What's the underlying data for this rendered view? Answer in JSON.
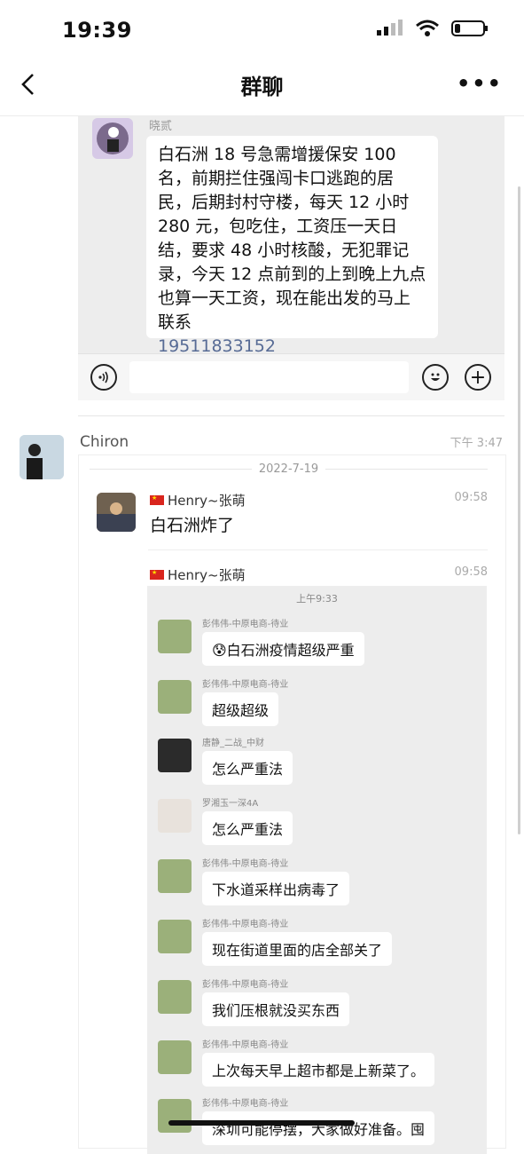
{
  "status": {
    "time": "19:39"
  },
  "nav": {
    "title": "群聊"
  },
  "top_quote": {
    "sender": "晓贰",
    "message": "白石洲 18 号急需增援保安 100 名，前期拦住强闯卡口逃跑的居民，后期封村守楼，每天 12 小时 280 元，包吃住，工资压一天日结，要求 48 小时核酸，无犯罪记录，今天 12 点前到的上到晚上九点也算一天工资，现在能出发的马上联系",
    "phone": "19511833152"
  },
  "chiron": {
    "name": "Chiron",
    "time": "下午 3:47"
  },
  "forwarded": {
    "date": "2022-7-19",
    "first": {
      "name": "Henry~张萌",
      "time": "09:58",
      "text": "白石洲炸了"
    },
    "second": {
      "name": "Henry~张萌",
      "time": "09:58"
    },
    "inner_time": "上午9:33",
    "messages": [
      {
        "name": "彭伟伟-中原电商-待业",
        "text": "😰白石洲疫情超级严重"
      },
      {
        "name": "彭伟伟-中原电商-待业",
        "text": "超级超级"
      },
      {
        "name": "唐静_二战_中财",
        "text": "怎么严重法"
      },
      {
        "name": "罗湘玉一深4A",
        "text": "怎么严重法"
      },
      {
        "name": "彭伟伟-中原电商-待业",
        "text": "下水道采样出病毒了"
      },
      {
        "name": "彭伟伟-中原电商-待业",
        "text": "现在街道里面的店全部关了"
      },
      {
        "name": "彭伟伟-中原电商-待业",
        "text": "我们压根就没买东西"
      },
      {
        "name": "彭伟伟-中原电商-待业",
        "text": "上次每天早上超市都是上新菜了。"
      },
      {
        "name": "彭伟伟-中原电商-待业",
        "text": "深圳可能停摆，大家做好准备。囤"
      }
    ]
  }
}
